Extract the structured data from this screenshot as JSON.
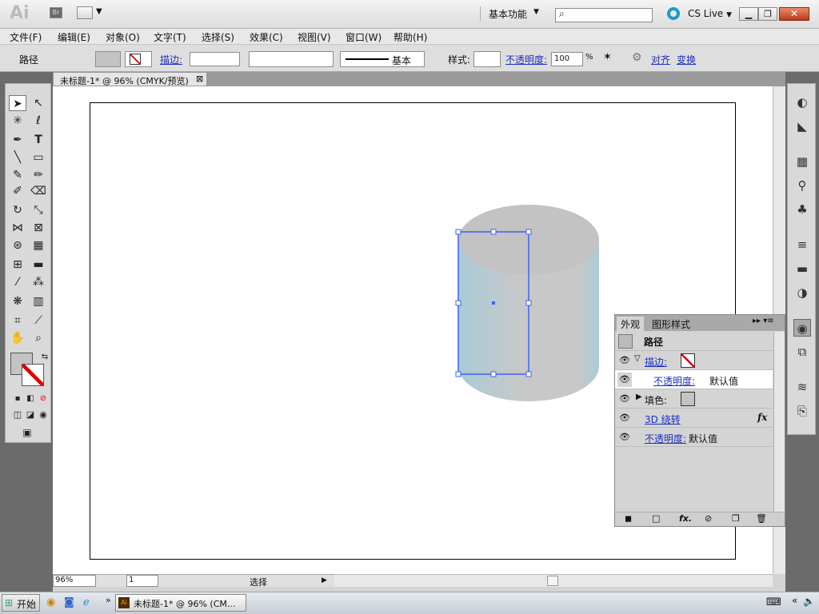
{
  "app": {
    "logo": "Ai",
    "bridge": "Br",
    "workspace": "基本功能",
    "search_placeholder": "",
    "cs_live": "CS Live"
  },
  "menus": [
    "文件(F)",
    "编辑(E)",
    "对象(O)",
    "文字(T)",
    "选择(S)",
    "效果(C)",
    "视图(V)",
    "窗口(W)",
    "帮助(H)"
  ],
  "control": {
    "selection": "路径",
    "stroke_label": "描边:",
    "brush": "基本",
    "style_label": "样式:",
    "opacity_label": "不透明度:",
    "opacity_value": "100",
    "opacity_unit": "%",
    "align": "对齐",
    "transform": "变换"
  },
  "document": {
    "tab_title": "未标题-1* @ 96% (CMYK/预览)"
  },
  "status": {
    "zoom": "96%",
    "page": "1",
    "mode": "选择"
  },
  "appearance_panel": {
    "tabs": [
      "外观",
      "图形样式"
    ],
    "object": "路径",
    "stroke": "描边:",
    "stroke_opacity_label": "不透明度:",
    "stroke_opacity_value": "默认值",
    "fill": "填色:",
    "effect": "3D 绕转",
    "fx": "fx",
    "opacity_label": "不透明度:",
    "opacity_value": "默认值"
  },
  "taskbar": {
    "start": "开始",
    "window": "未标题-1* @ 96% (CM..."
  },
  "colors": {
    "cyl_light": "#a9cbd8",
    "cyl_grey": "#c3c3c3",
    "selection": "#3b63f2"
  }
}
